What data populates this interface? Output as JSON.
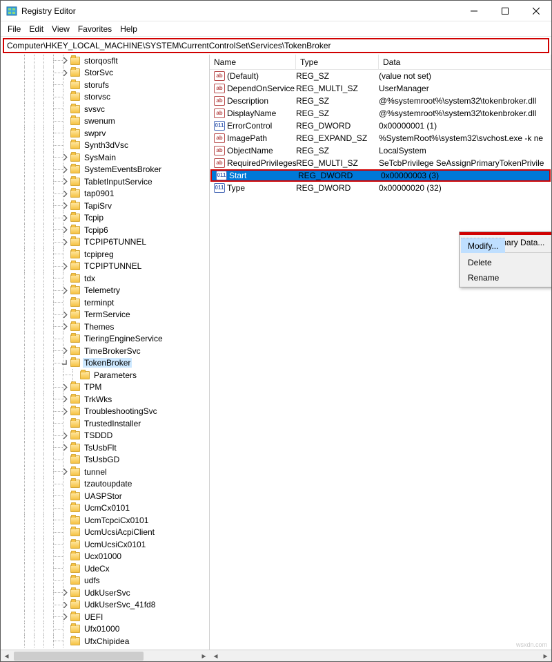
{
  "window": {
    "title": "Registry Editor"
  },
  "menu": {
    "file": "File",
    "edit": "Edit",
    "view": "View",
    "favorites": "Favorites",
    "help": "Help"
  },
  "address": "Computer\\HKEY_LOCAL_MACHINE\\SYSTEM\\CurrentControlSet\\Services\\TokenBroker",
  "columns": {
    "name": "Name",
    "type": "Type",
    "data": "Data"
  },
  "tree": [
    {
      "name": "storqosflt",
      "indent": 4,
      "chev": "r"
    },
    {
      "name": "StorSvc",
      "indent": 4,
      "chev": "r"
    },
    {
      "name": "storufs",
      "indent": 4
    },
    {
      "name": "storvsc",
      "indent": 4
    },
    {
      "name": "svsvc",
      "indent": 4
    },
    {
      "name": "swenum",
      "indent": 4
    },
    {
      "name": "swprv",
      "indent": 4
    },
    {
      "name": "Synth3dVsc",
      "indent": 4
    },
    {
      "name": "SysMain",
      "indent": 4,
      "chev": "r"
    },
    {
      "name": "SystemEventsBroker",
      "indent": 4,
      "chev": "r"
    },
    {
      "name": "TabletInputService",
      "indent": 4,
      "chev": "r"
    },
    {
      "name": "tap0901",
      "indent": 4,
      "chev": "r"
    },
    {
      "name": "TapiSrv",
      "indent": 4,
      "chev": "r"
    },
    {
      "name": "Tcpip",
      "indent": 4,
      "chev": "r"
    },
    {
      "name": "Tcpip6",
      "indent": 4,
      "chev": "r"
    },
    {
      "name": "TCPIP6TUNNEL",
      "indent": 4,
      "chev": "r"
    },
    {
      "name": "tcpipreg",
      "indent": 4
    },
    {
      "name": "TCPIPTUNNEL",
      "indent": 4,
      "chev": "r"
    },
    {
      "name": "tdx",
      "indent": 4
    },
    {
      "name": "Telemetry",
      "indent": 4,
      "chev": "r"
    },
    {
      "name": "terminpt",
      "indent": 4
    },
    {
      "name": "TermService",
      "indent": 4,
      "chev": "r"
    },
    {
      "name": "Themes",
      "indent": 4,
      "chev": "r"
    },
    {
      "name": "TieringEngineService",
      "indent": 4
    },
    {
      "name": "TimeBrokerSvc",
      "indent": 4,
      "chev": "r"
    },
    {
      "name": "TokenBroker",
      "indent": 4,
      "chev": "d",
      "sel": true
    },
    {
      "name": "Parameters",
      "indent": 5
    },
    {
      "name": "TPM",
      "indent": 4,
      "chev": "r"
    },
    {
      "name": "TrkWks",
      "indent": 4,
      "chev": "r"
    },
    {
      "name": "TroubleshootingSvc",
      "indent": 4,
      "chev": "r"
    },
    {
      "name": "TrustedInstaller",
      "indent": 4
    },
    {
      "name": "TSDDD",
      "indent": 4,
      "chev": "r"
    },
    {
      "name": "TsUsbFlt",
      "indent": 4,
      "chev": "r"
    },
    {
      "name": "TsUsbGD",
      "indent": 4
    },
    {
      "name": "tunnel",
      "indent": 4,
      "chev": "r"
    },
    {
      "name": "tzautoupdate",
      "indent": 4
    },
    {
      "name": "UASPStor",
      "indent": 4
    },
    {
      "name": "UcmCx0101",
      "indent": 4
    },
    {
      "name": "UcmTcpciCx0101",
      "indent": 4
    },
    {
      "name": "UcmUcsiAcpiClient",
      "indent": 4
    },
    {
      "name": "UcmUcsiCx0101",
      "indent": 4
    },
    {
      "name": "Ucx01000",
      "indent": 4
    },
    {
      "name": "UdeCx",
      "indent": 4
    },
    {
      "name": "udfs",
      "indent": 4
    },
    {
      "name": "UdkUserSvc",
      "indent": 4,
      "chev": "r"
    },
    {
      "name": "UdkUserSvc_41fd8",
      "indent": 4,
      "chev": "r"
    },
    {
      "name": "UEFI",
      "indent": 4,
      "chev": "r"
    },
    {
      "name": "Ufx01000",
      "indent": 4
    },
    {
      "name": "UfxChipidea",
      "indent": 4
    }
  ],
  "values": [
    {
      "icon": "sz",
      "name": "(Default)",
      "type": "REG_SZ",
      "data": "(value not set)"
    },
    {
      "icon": "sz",
      "name": "DependOnService",
      "type": "REG_MULTI_SZ",
      "data": "UserManager"
    },
    {
      "icon": "sz",
      "name": "Description",
      "type": "REG_SZ",
      "data": "@%systemroot%\\system32\\tokenbroker.dll"
    },
    {
      "icon": "sz",
      "name": "DisplayName",
      "type": "REG_SZ",
      "data": "@%systemroot%\\system32\\tokenbroker.dll"
    },
    {
      "icon": "dw",
      "name": "ErrorControl",
      "type": "REG_DWORD",
      "data": "0x00000001 (1)"
    },
    {
      "icon": "sz",
      "name": "ImagePath",
      "type": "REG_EXPAND_SZ",
      "data": "%SystemRoot%\\system32\\svchost.exe -k ne"
    },
    {
      "icon": "sz",
      "name": "ObjectName",
      "type": "REG_SZ",
      "data": "LocalSystem"
    },
    {
      "icon": "sz",
      "name": "RequiredPrivileges",
      "type": "REG_MULTI_SZ",
      "data": "SeTcbPrivilege SeAssignPrimaryTokenPrivile"
    },
    {
      "icon": "dw",
      "name": "Start",
      "type": "REG_DWORD",
      "data": "0x00000003 (3)",
      "hi": true
    },
    {
      "icon": "dw",
      "name": "Type",
      "type": "REG_DWORD",
      "data": "0x00000020 (32)"
    }
  ],
  "ctx": {
    "modify": "Modify...",
    "modifyBinary": "Modify Binary Data...",
    "delete": "Delete",
    "rename": "Rename"
  },
  "watermark": "wsxdn.com"
}
